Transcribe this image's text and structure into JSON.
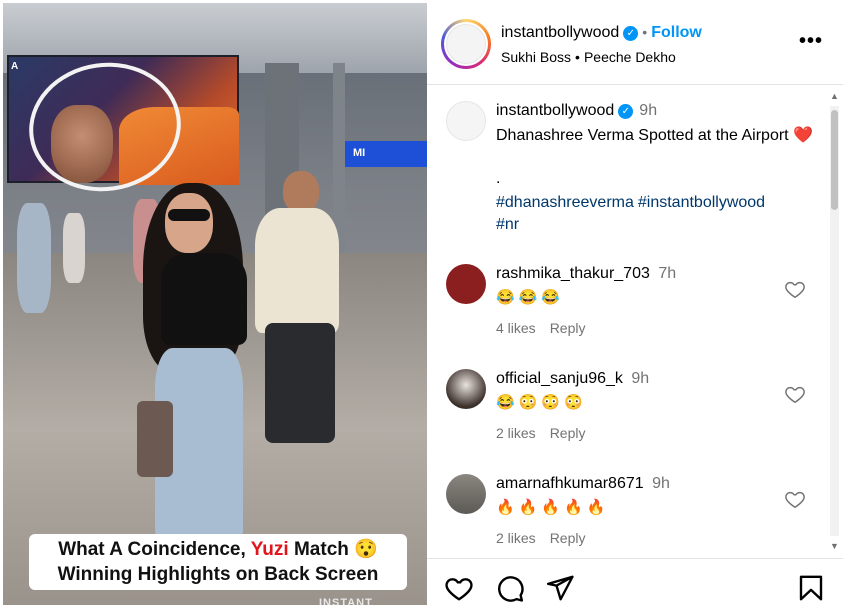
{
  "media": {
    "caption_before": "What A Coincidence, ",
    "caption_highlight": "Yuzi",
    "caption_after": " Match 😯",
    "caption_line2": "Winning Highlights on Back Screen",
    "watermark": "INSTANT",
    "screen_logo": "A",
    "signboard": "MI"
  },
  "header": {
    "username": "instantbollywood",
    "verified_mark": "✓",
    "separator": "•",
    "follow_label": "Follow",
    "audio_artist": "Sukhi Boss",
    "audio_title": "Peeche Dekho",
    "more_label": "•••"
  },
  "caption": {
    "username": "instantbollywood",
    "time": "9h",
    "text": "Dhanashree Verma Spotted at the Airport",
    "heart": "❤️",
    "dot": ".",
    "hashtags": [
      "#dhanashreeverma",
      "#instantbollywood",
      "#nr"
    ]
  },
  "comments": [
    {
      "username": "rashmika_thakur_703",
      "time": "7h",
      "emoji": "😂😂😂",
      "likes": "4 likes",
      "reply": "Reply",
      "avatar_color": "#8b1e1e"
    },
    {
      "username": "official_sanju96_k",
      "time": "9h",
      "emoji": "😂😳😳😳",
      "likes": "2 likes",
      "reply": "Reply",
      "avatar_color": "#3b2f2a"
    },
    {
      "username": "amarnafhkumar8671",
      "time": "9h",
      "emoji": "🔥🔥🔥🔥🔥",
      "likes": "2 likes",
      "reply": "Reply",
      "avatar_color": "#5c5a55"
    }
  ],
  "scroll": {
    "up": "▲",
    "down": "▼"
  },
  "actions": {
    "like_icon": "heart-outline-icon",
    "comment_icon": "comment-bubble-icon",
    "share_icon": "paper-plane-icon",
    "save_icon": "bookmark-icon"
  },
  "colors": {
    "link_blue": "#0095f6",
    "hashtag": "#00376b",
    "secondary": "#737373",
    "highlight_red": "#e2141c"
  }
}
